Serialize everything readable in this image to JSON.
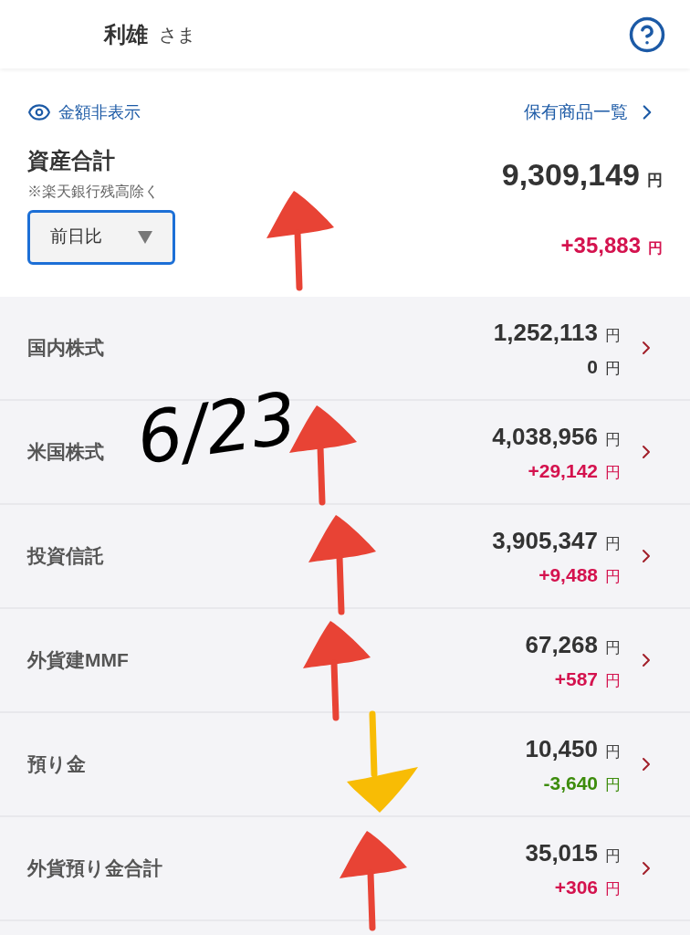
{
  "header": {
    "name": "利雄",
    "honorific": "さま"
  },
  "summary": {
    "hide_amounts": "金額非表示",
    "holdings_link": "保有商品一覧",
    "title": "資産合計",
    "note": "※楽天銀行残高除く",
    "compare_select": {
      "value": "前日比"
    },
    "total": "9,309,149",
    "total_unit": "円",
    "change": {
      "text": "+35,883",
      "color": "#d4124e"
    },
    "change_unit": "円"
  },
  "categories": [
    {
      "label": "国内株式",
      "amount": "1,252,113",
      "amount_unit": "円",
      "change": {
        "text": "0",
        "color": "#333333"
      },
      "change_unit": "円"
    },
    {
      "label": "米国株式",
      "amount": "4,038,956",
      "amount_unit": "円",
      "change": {
        "text": "+29,142",
        "color": "#d4124e"
      },
      "change_unit": "円"
    },
    {
      "label": "投資信託",
      "amount": "3,905,347",
      "amount_unit": "円",
      "change": {
        "text": "+9,488",
        "color": "#d4124e"
      },
      "change_unit": "円"
    },
    {
      "label": "外貨建MMF",
      "amount": "67,268",
      "amount_unit": "円",
      "change": {
        "text": "+587",
        "color": "#d4124e"
      },
      "change_unit": "円"
    },
    {
      "label": "預り金",
      "amount": "10,450",
      "amount_unit": "円",
      "change": {
        "text": "-3,640",
        "color": "#3d8c0c"
      },
      "change_unit": "円"
    },
    {
      "label": "外貨預り金合計",
      "amount": "35,015",
      "amount_unit": "円",
      "change": {
        "text": "+306",
        "color": "#d4124e"
      },
      "change_unit": "円"
    }
  ],
  "annotations": {
    "handwritten_note": "6/23",
    "arrows": [
      {
        "kind": "up",
        "color": "#e84335"
      },
      {
        "kind": "up",
        "color": "#e84335"
      },
      {
        "kind": "up",
        "color": "#e84335"
      },
      {
        "kind": "up",
        "color": "#e84335"
      },
      {
        "kind": "down",
        "color": "#f8bc05"
      },
      {
        "kind": "up",
        "color": "#e84335"
      }
    ]
  }
}
